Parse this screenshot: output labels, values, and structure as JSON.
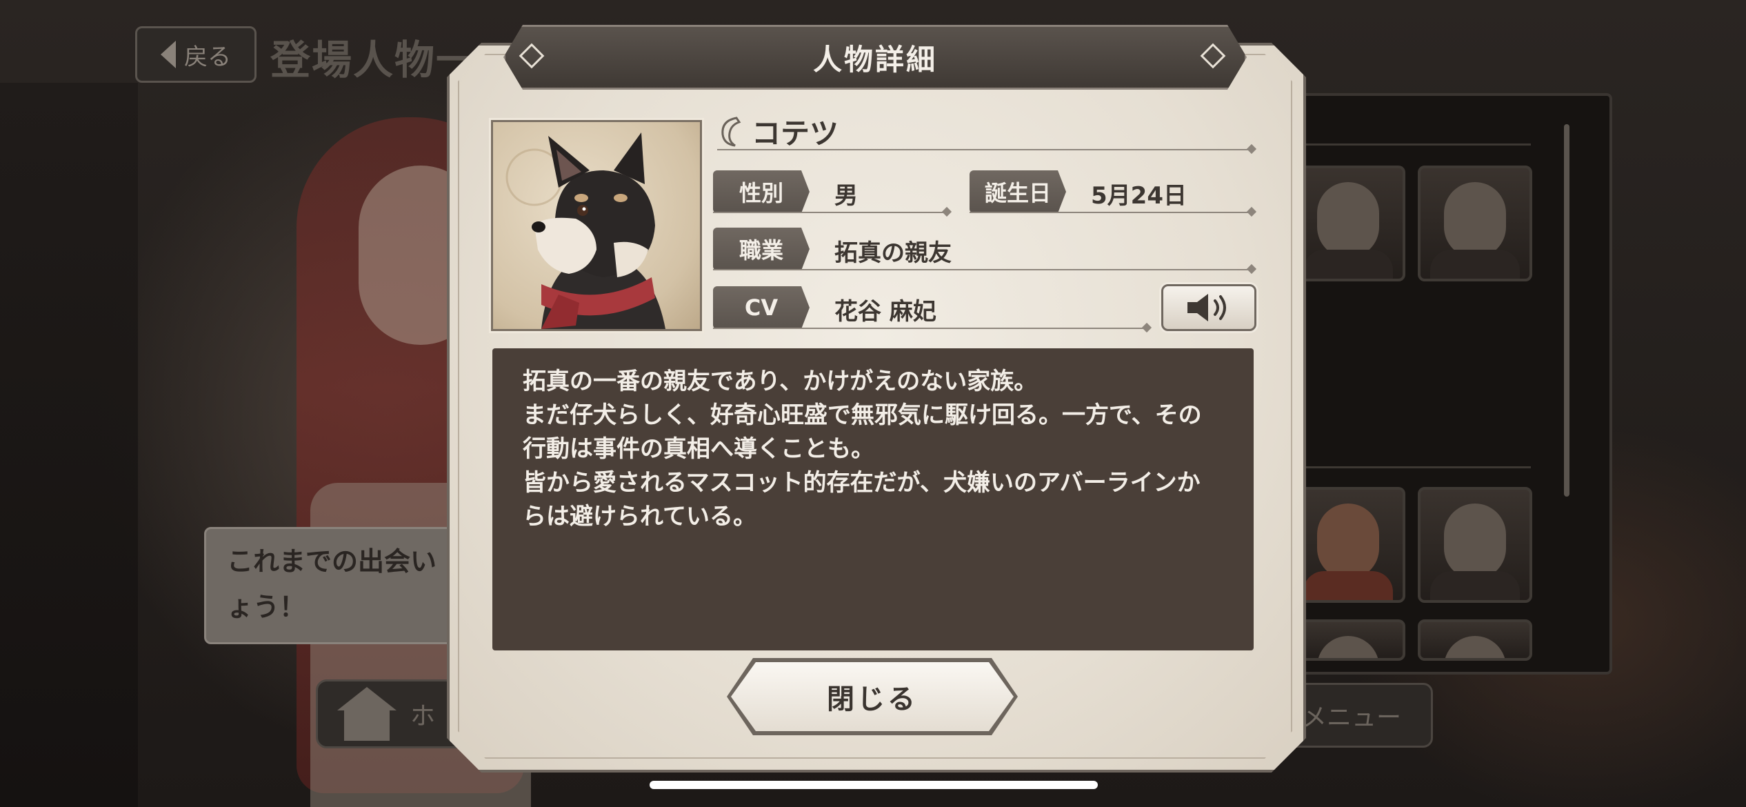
{
  "background": {
    "back_label": "戻る",
    "screen_title": "登場人物一",
    "speech_lines": [
      "これまでの出会い",
      "ょう！"
    ],
    "home_label": "ホ",
    "menu_label": "メニュー"
  },
  "dialog": {
    "title": "人物詳細",
    "name": "コテツ",
    "fields": {
      "gender_label": "性別",
      "gender_value": "男",
      "birthday_label": "誕生日",
      "birthday_value": "5月24日",
      "occupation_label": "職業",
      "occupation_value": "拓真の親友",
      "cv_label": "CV",
      "cv_value": "花谷 麻妃"
    },
    "description_lines": [
      "拓真の一番の親友であり、かけがえのない家族。",
      "まだ仔犬らしく、好奇心旺盛で無邪気に駆け回る。一方で、その",
      "行動は事件の真相へ導くことも。",
      "皆から愛されるマスコット的存在だが、犬嫌いのアバーラインか",
      "らは避けられている。"
    ],
    "close_label": "閉じる"
  },
  "colors": {
    "dialog_bg": "#e9e3d8",
    "label_bg": "#625a54",
    "desc_bg": "#4a3f38",
    "text_dark": "#3c3631"
  },
  "icons": [
    "speaker-icon",
    "leaf-ornament-icon",
    "house-icon",
    "back-arrow-icon"
  ]
}
